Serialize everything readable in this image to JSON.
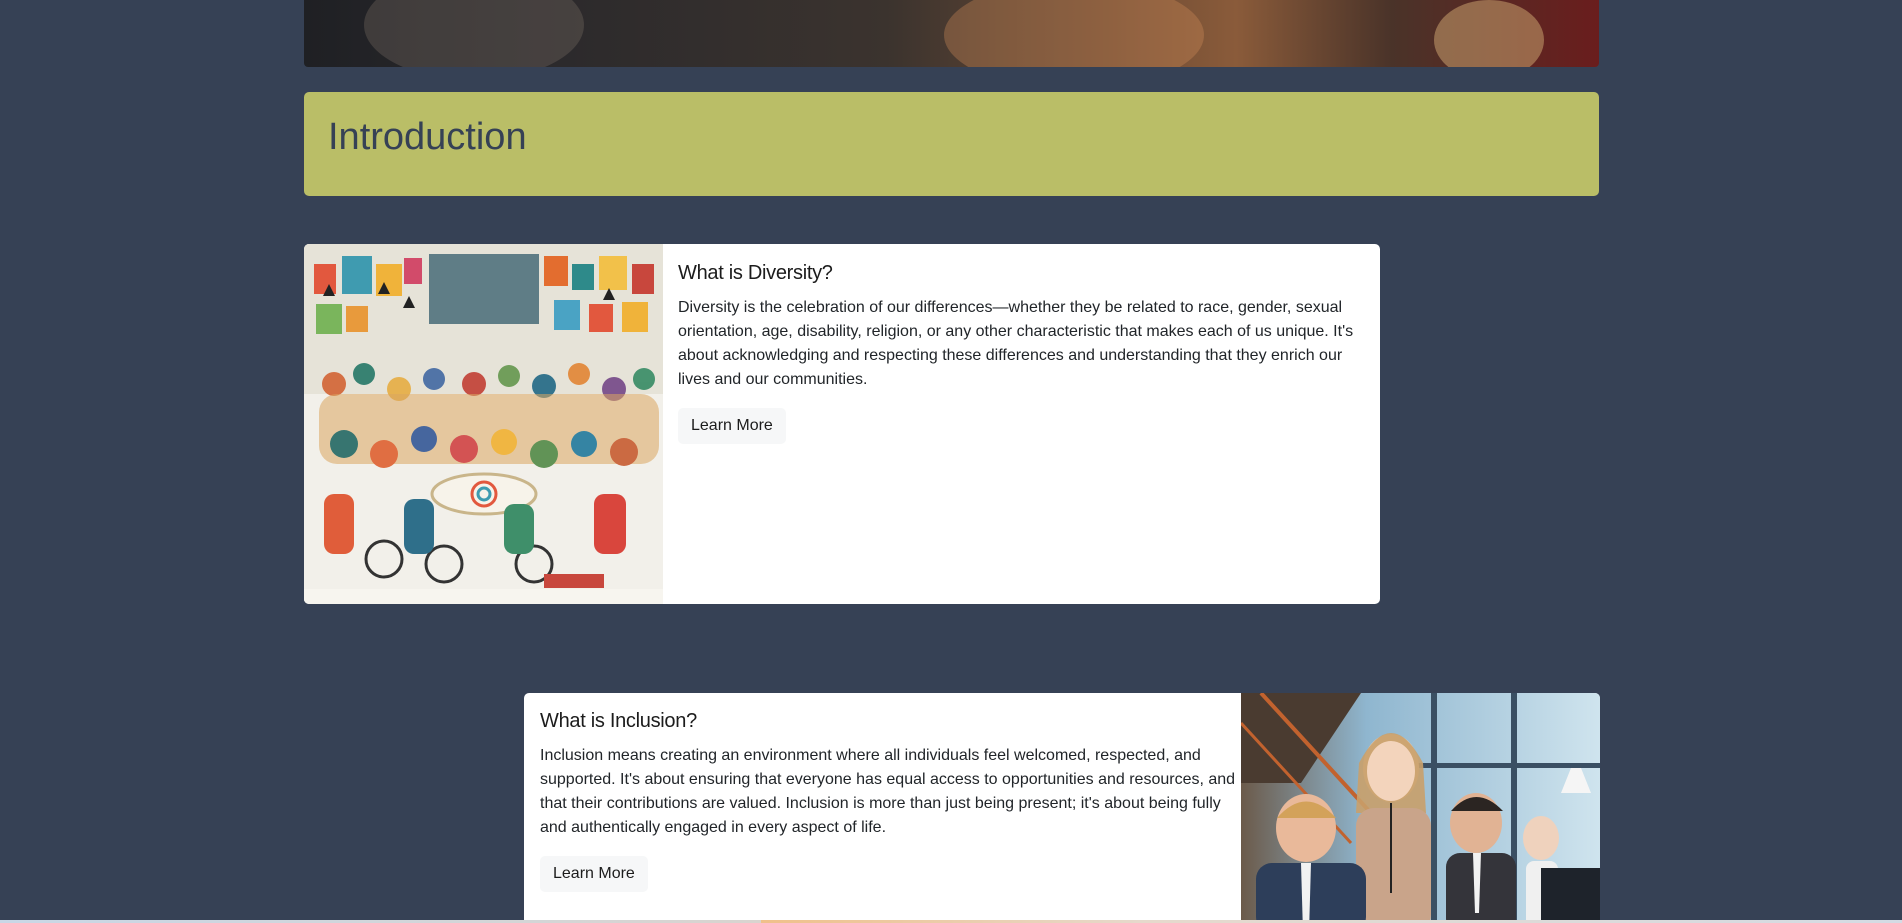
{
  "intro": {
    "title": "Introduction"
  },
  "diversity": {
    "title": "What is Diversity?",
    "text": "Diversity is the celebration of our differences—whether they be related to race, gender, sexual orientation, age, disability, religion, or any other characteristic that makes each of us unique. It's about acknowledging and respecting these differences and understanding that they enrich our lives and our communities.",
    "button": "Learn More",
    "image_icon": "community-gathering-illustration"
  },
  "inclusion": {
    "title": "What is Inclusion?",
    "text": "Inclusion means creating an environment where all individuals feel welcomed, respected, and supported. It's about ensuring that everyone has equal access to opportunities and resources, and that their contributions are valued. Inclusion is more than just being present; it's about being fully and authentically engaged in every aspect of life.",
    "button": "Learn More",
    "image_icon": "office-team-photo"
  },
  "colors": {
    "background": "#364155",
    "banner": "#babe67",
    "card": "#ffffff",
    "button": "#f6f7f8"
  }
}
